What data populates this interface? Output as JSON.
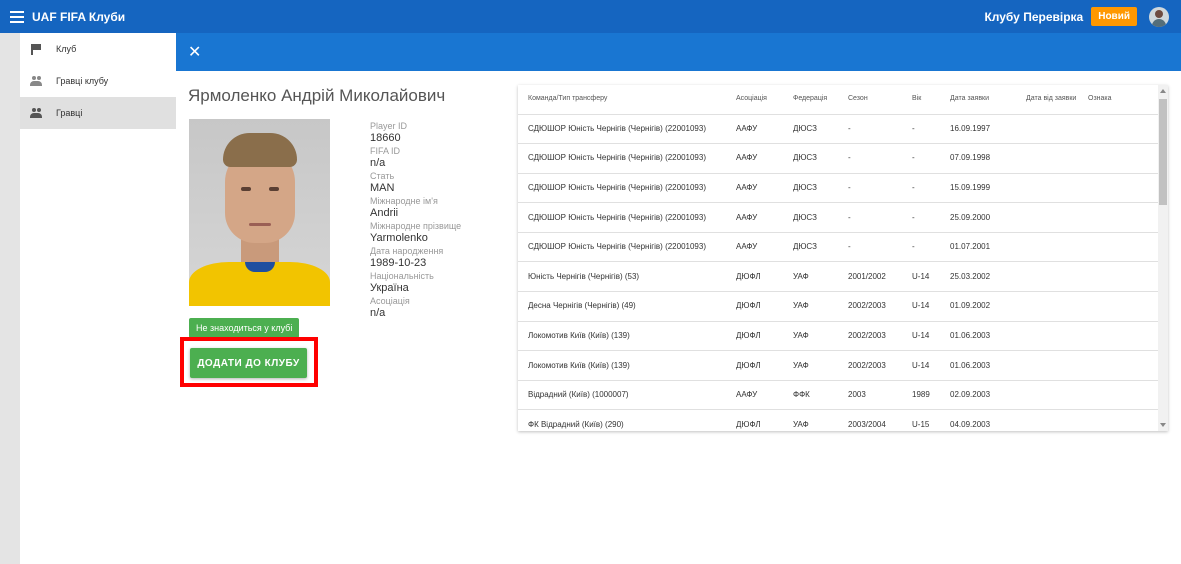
{
  "app": {
    "title": "UAF FIFA Клуби",
    "club_label": "Клубу Перевірка",
    "new_button": "Новий"
  },
  "sidebar": {
    "items": [
      {
        "label": "Клуб"
      },
      {
        "label": "Гравці клубу"
      },
      {
        "label": "Гравці"
      }
    ]
  },
  "dialog": {
    "close": "✕",
    "player_name": "Ярмоленко Андрій Миколайович",
    "status_badge": "Не знаходиться у клубі",
    "add_button": "ДОДАТИ ДО КЛУБУ",
    "info": {
      "player_id_label": "Player ID",
      "player_id": "18660",
      "fifa_id_label": "FIFA ID",
      "fifa_id": "n/a",
      "gender_label": "Стать",
      "gender": "MAN",
      "intl_name_label": "Міжнародне ім'я",
      "intl_name": "Andrii",
      "intl_surname_label": "Міжнародне прізвище",
      "intl_surname": "Yarmolenko",
      "birth_label": "Дата народження",
      "birth": "1989-10-23",
      "nationality_label": "Національність",
      "nationality": "Україна",
      "association_label": "Асоціація",
      "association": "n/a"
    }
  },
  "table": {
    "headers": [
      "Команда/Тип трансферу",
      "Асоціація",
      "Федерація",
      "Сезон",
      "Вік",
      "Дата заявки",
      "Дата від заявки",
      "Ознака"
    ],
    "rows": [
      [
        "СДЮШОР Юність Чернігів (Чернігів) (22001093)",
        "ААФУ",
        "ДЮСЗ",
        "-",
        "-",
        "16.09.1997",
        "",
        ""
      ],
      [
        "СДЮШОР Юність Чернігів (Чернігів) (22001093)",
        "ААФУ",
        "ДЮСЗ",
        "-",
        "-",
        "07.09.1998",
        "",
        ""
      ],
      [
        "СДЮШОР Юність Чернігів (Чернігів) (22001093)",
        "ААФУ",
        "ДЮСЗ",
        "-",
        "-",
        "15.09.1999",
        "",
        ""
      ],
      [
        "СДЮШОР Юність Чернігів (Чернігів) (22001093)",
        "ААФУ",
        "ДЮСЗ",
        "-",
        "-",
        "25.09.2000",
        "",
        ""
      ],
      [
        "СДЮШОР Юність Чернігів (Чернігів) (22001093)",
        "ААФУ",
        "ДЮСЗ",
        "-",
        "-",
        "01.07.2001",
        "",
        ""
      ],
      [
        "Юність Чернігів (Чернігів) (53)",
        "ДЮФЛ",
        "УАФ",
        "2001/2002",
        "U-14",
        "25.03.2002",
        "",
        ""
      ],
      [
        "Десна Чернігів (Чернігів) (49)",
        "ДЮФЛ",
        "УАФ",
        "2002/2003",
        "U-14",
        "01.09.2002",
        "",
        ""
      ],
      [
        "Локомотив Київ (Київ) (139)",
        "ДЮФЛ",
        "УАФ",
        "2002/2003",
        "U-14",
        "01.06.2003",
        "",
        ""
      ],
      [
        "Локомотив Київ (Київ) (139)",
        "ДЮФЛ",
        "УАФ",
        "2002/2003",
        "U-14",
        "01.06.2003",
        "",
        ""
      ],
      [
        "Відрадний (Київ) (1000007)",
        "ААФУ",
        "ФФК",
        "2003",
        "1989",
        "02.09.2003",
        "",
        ""
      ],
      [
        "ФК Відрадний (Київ) (290)",
        "ДЮФЛ",
        "УАФ",
        "2003/2004",
        "U-15",
        "04.09.2003",
        "",
        ""
      ]
    ]
  },
  "colors": {
    "appbar": "#1565c0",
    "dialog_header": "#1976d2",
    "new_button": "#ff9800",
    "success": "#4caf50",
    "highlight": "#ff0000"
  }
}
